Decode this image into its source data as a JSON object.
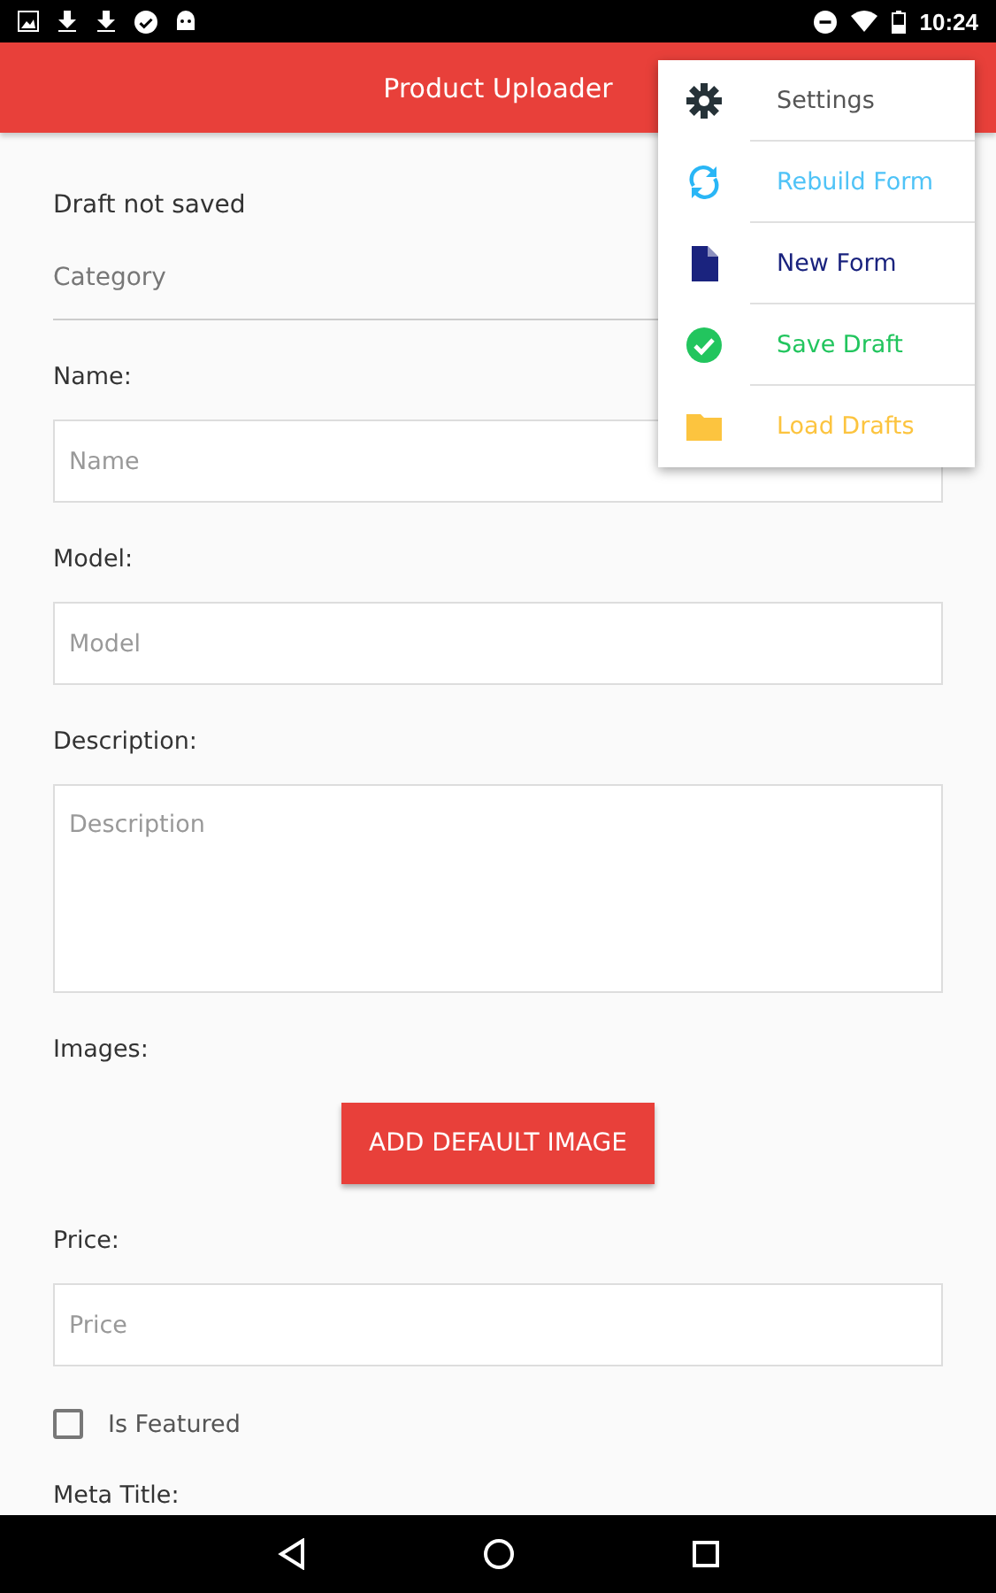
{
  "status_bar": {
    "time": "10:24"
  },
  "app_bar": {
    "title": "Product Uploader"
  },
  "menu": [
    {
      "kind": "settings",
      "label": "Settings",
      "color": "#555555"
    },
    {
      "kind": "rebuild",
      "label": "Rebuild Form",
      "color": "#4fc3f7"
    },
    {
      "kind": "new",
      "label": "New Form",
      "color": "#1a237e"
    },
    {
      "kind": "save",
      "label": "Save Draft",
      "color": "#22c55e"
    },
    {
      "kind": "load",
      "label": "Load Drafts",
      "color": "#fcc43f"
    }
  ],
  "form": {
    "draft_status": "Draft not saved",
    "category": {
      "placeholder": "Category"
    },
    "fields": [
      {
        "kind": "input",
        "label": "Name:",
        "placeholder": "Name"
      },
      {
        "kind": "input",
        "label": "Model:",
        "placeholder": "Model"
      },
      {
        "kind": "textarea",
        "label": "Description:",
        "placeholder": "Description"
      },
      {
        "kind": "button",
        "label": "Images:",
        "button": "ADD DEFAULT IMAGE"
      },
      {
        "kind": "input",
        "label": "Price:",
        "placeholder": "Price"
      },
      {
        "kind": "checkbox",
        "label": "Is Featured",
        "checked": false
      },
      {
        "kind": "heading",
        "label": "Meta Title:"
      }
    ]
  }
}
